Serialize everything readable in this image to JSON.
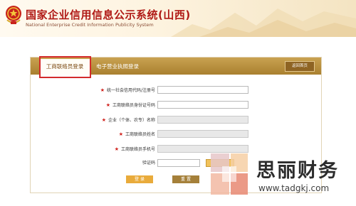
{
  "header": {
    "title_cn": "国家企业信用信息公示系统(山西)",
    "title_en": "National Enterprise Credit Information Publicity System",
    "emblem_icon": "national-emblem-icon"
  },
  "login": {
    "tabs": [
      {
        "label": "工商联络员登录",
        "active": true
      },
      {
        "label": "电子营业执照登录",
        "active": false
      }
    ],
    "home_button": "返回首页",
    "fields": [
      {
        "label": "统一社会信用代码/注册号",
        "required": true,
        "disabled": false,
        "value": ""
      },
      {
        "label": "工商联络员身份证号码",
        "required": true,
        "disabled": false,
        "value": ""
      },
      {
        "label": "企业（个体、农专）名称",
        "required": true,
        "disabled": true,
        "value": ""
      },
      {
        "label": "工商联络员姓名",
        "required": true,
        "disabled": true,
        "value": ""
      },
      {
        "label": "工商联络员手机号",
        "required": true,
        "disabled": true,
        "value": ""
      }
    ],
    "captcha": {
      "label": "验证码",
      "value": "",
      "image_text": ""
    },
    "submit_button": "登 录",
    "reset_button": "重 置",
    "colors": {
      "tab_bar": "#b88f3e",
      "accent_red": "#d32a2a",
      "login_button": "#e9ab3b",
      "reset_button": "#a5803a"
    }
  },
  "watermark": {
    "brand": "思丽财务",
    "url": "www.tadgkj.com"
  }
}
